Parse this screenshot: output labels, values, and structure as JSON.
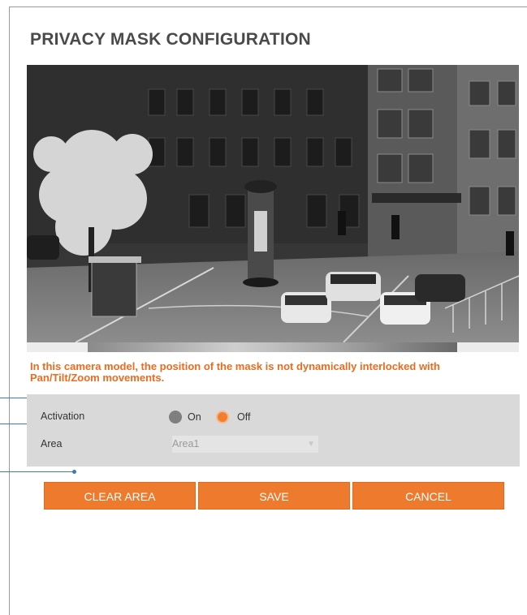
{
  "page": {
    "title": "PRIVACY MASK CONFIGURATION"
  },
  "notice": {
    "line1": "In this camera model, the position of the mask is not dynamically interlocked with",
    "line2": "Pan/Tilt/Zoom movements."
  },
  "form": {
    "activation": {
      "label": "Activation",
      "options": [
        {
          "label": "On",
          "selected": false
        },
        {
          "label": "Off",
          "selected": true
        }
      ]
    },
    "area": {
      "label": "Area",
      "value": "Area1"
    }
  },
  "buttons": {
    "clear_area": "CLEAR AREA",
    "save": "SAVE",
    "cancel": "CANCEL"
  },
  "colors": {
    "accent": "#ee7a2e",
    "warning_text": "#ee6b1e",
    "pointer": "#3c79b7",
    "panel": "#d9d9d9"
  },
  "icons": {
    "dropdown": "chevron-down-icon"
  }
}
